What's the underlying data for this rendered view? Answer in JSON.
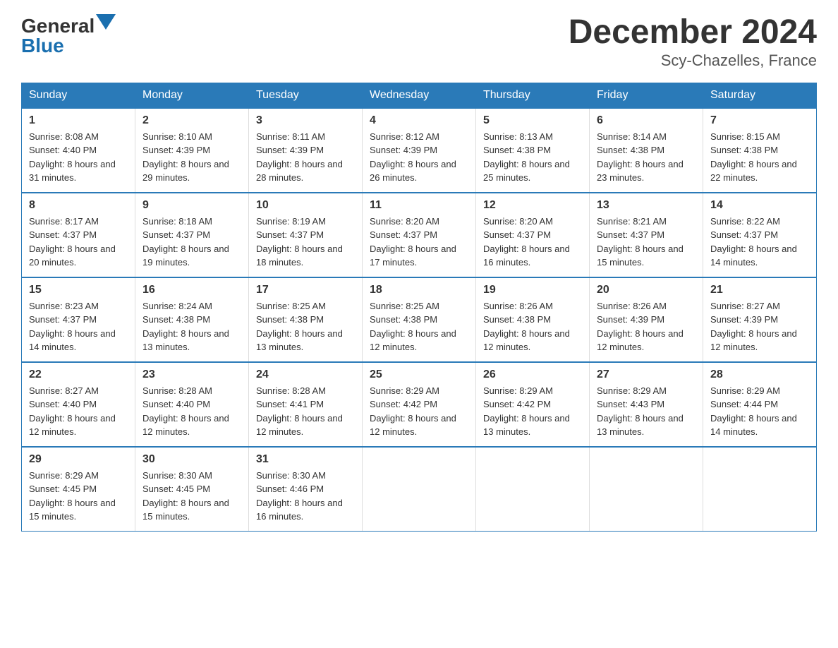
{
  "logo": {
    "general": "General",
    "blue": "Blue"
  },
  "title": "December 2024",
  "subtitle": "Scy-Chazelles, France",
  "days_header": [
    "Sunday",
    "Monday",
    "Tuesday",
    "Wednesday",
    "Thursday",
    "Friday",
    "Saturday"
  ],
  "weeks": [
    [
      {
        "num": "1",
        "sunrise": "8:08 AM",
        "sunset": "4:40 PM",
        "daylight": "8 hours and 31 minutes."
      },
      {
        "num": "2",
        "sunrise": "8:10 AM",
        "sunset": "4:39 PM",
        "daylight": "8 hours and 29 minutes."
      },
      {
        "num": "3",
        "sunrise": "8:11 AM",
        "sunset": "4:39 PM",
        "daylight": "8 hours and 28 minutes."
      },
      {
        "num": "4",
        "sunrise": "8:12 AM",
        "sunset": "4:39 PM",
        "daylight": "8 hours and 26 minutes."
      },
      {
        "num": "5",
        "sunrise": "8:13 AM",
        "sunset": "4:38 PM",
        "daylight": "8 hours and 25 minutes."
      },
      {
        "num": "6",
        "sunrise": "8:14 AM",
        "sunset": "4:38 PM",
        "daylight": "8 hours and 23 minutes."
      },
      {
        "num": "7",
        "sunrise": "8:15 AM",
        "sunset": "4:38 PM",
        "daylight": "8 hours and 22 minutes."
      }
    ],
    [
      {
        "num": "8",
        "sunrise": "8:17 AM",
        "sunset": "4:37 PM",
        "daylight": "8 hours and 20 minutes."
      },
      {
        "num": "9",
        "sunrise": "8:18 AM",
        "sunset": "4:37 PM",
        "daylight": "8 hours and 19 minutes."
      },
      {
        "num": "10",
        "sunrise": "8:19 AM",
        "sunset": "4:37 PM",
        "daylight": "8 hours and 18 minutes."
      },
      {
        "num": "11",
        "sunrise": "8:20 AM",
        "sunset": "4:37 PM",
        "daylight": "8 hours and 17 minutes."
      },
      {
        "num": "12",
        "sunrise": "8:20 AM",
        "sunset": "4:37 PM",
        "daylight": "8 hours and 16 minutes."
      },
      {
        "num": "13",
        "sunrise": "8:21 AM",
        "sunset": "4:37 PM",
        "daylight": "8 hours and 15 minutes."
      },
      {
        "num": "14",
        "sunrise": "8:22 AM",
        "sunset": "4:37 PM",
        "daylight": "8 hours and 14 minutes."
      }
    ],
    [
      {
        "num": "15",
        "sunrise": "8:23 AM",
        "sunset": "4:37 PM",
        "daylight": "8 hours and 14 minutes."
      },
      {
        "num": "16",
        "sunrise": "8:24 AM",
        "sunset": "4:38 PM",
        "daylight": "8 hours and 13 minutes."
      },
      {
        "num": "17",
        "sunrise": "8:25 AM",
        "sunset": "4:38 PM",
        "daylight": "8 hours and 13 minutes."
      },
      {
        "num": "18",
        "sunrise": "8:25 AM",
        "sunset": "4:38 PM",
        "daylight": "8 hours and 12 minutes."
      },
      {
        "num": "19",
        "sunrise": "8:26 AM",
        "sunset": "4:38 PM",
        "daylight": "8 hours and 12 minutes."
      },
      {
        "num": "20",
        "sunrise": "8:26 AM",
        "sunset": "4:39 PM",
        "daylight": "8 hours and 12 minutes."
      },
      {
        "num": "21",
        "sunrise": "8:27 AM",
        "sunset": "4:39 PM",
        "daylight": "8 hours and 12 minutes."
      }
    ],
    [
      {
        "num": "22",
        "sunrise": "8:27 AM",
        "sunset": "4:40 PM",
        "daylight": "8 hours and 12 minutes."
      },
      {
        "num": "23",
        "sunrise": "8:28 AM",
        "sunset": "4:40 PM",
        "daylight": "8 hours and 12 minutes."
      },
      {
        "num": "24",
        "sunrise": "8:28 AM",
        "sunset": "4:41 PM",
        "daylight": "8 hours and 12 minutes."
      },
      {
        "num": "25",
        "sunrise": "8:29 AM",
        "sunset": "4:42 PM",
        "daylight": "8 hours and 12 minutes."
      },
      {
        "num": "26",
        "sunrise": "8:29 AM",
        "sunset": "4:42 PM",
        "daylight": "8 hours and 13 minutes."
      },
      {
        "num": "27",
        "sunrise": "8:29 AM",
        "sunset": "4:43 PM",
        "daylight": "8 hours and 13 minutes."
      },
      {
        "num": "28",
        "sunrise": "8:29 AM",
        "sunset": "4:44 PM",
        "daylight": "8 hours and 14 minutes."
      }
    ],
    [
      {
        "num": "29",
        "sunrise": "8:29 AM",
        "sunset": "4:45 PM",
        "daylight": "8 hours and 15 minutes."
      },
      {
        "num": "30",
        "sunrise": "8:30 AM",
        "sunset": "4:45 PM",
        "daylight": "8 hours and 15 minutes."
      },
      {
        "num": "31",
        "sunrise": "8:30 AM",
        "sunset": "4:46 PM",
        "daylight": "8 hours and 16 minutes."
      },
      null,
      null,
      null,
      null
    ]
  ]
}
